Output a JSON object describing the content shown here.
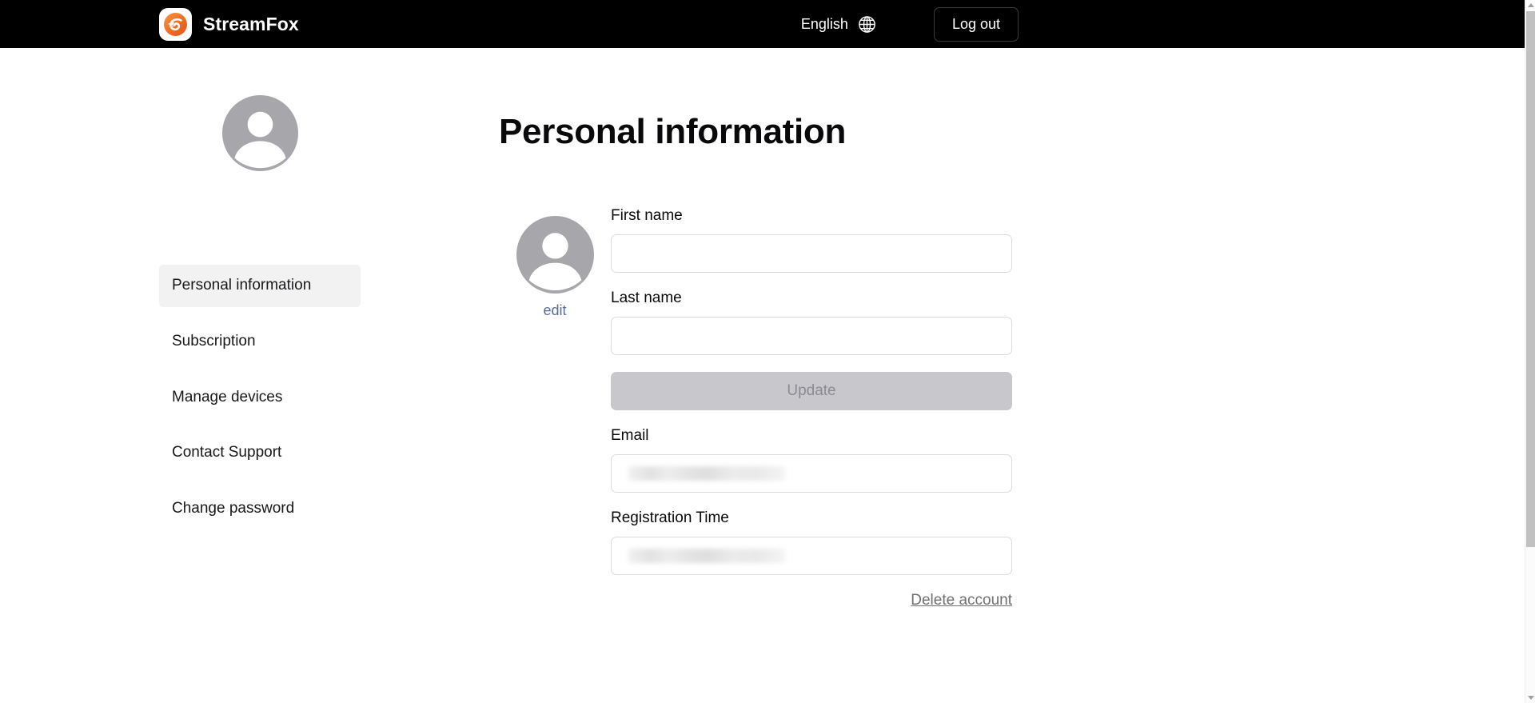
{
  "header": {
    "brand_name": "StreamFox",
    "brand_logo_icon": "streamfox-logo-icon",
    "language_label": "English",
    "globe_icon": "globe-icon",
    "logout_label": "Log out"
  },
  "sidebar": {
    "avatar_icon": "user-avatar-icon",
    "items": [
      {
        "label": "Personal information",
        "active": true
      },
      {
        "label": "Subscription",
        "active": false
      },
      {
        "label": "Manage devices",
        "active": false
      },
      {
        "label": "Contact Support",
        "active": false
      },
      {
        "label": "Change password",
        "active": false
      }
    ]
  },
  "main": {
    "page_title": "Personal information",
    "avatar_icon": "user-avatar-icon",
    "edit_label": "edit",
    "first_name": {
      "label": "First name",
      "value": "",
      "placeholder": ""
    },
    "last_name": {
      "label": "Last name",
      "value": "",
      "placeholder": ""
    },
    "update_label": "Update",
    "email": {
      "label": "Email",
      "value": "",
      "redacted": true
    },
    "registration_time": {
      "label": "Registration Time",
      "value": "",
      "redacted": true
    },
    "delete_account_label": "Delete account"
  },
  "colors": {
    "header_bg": "#000000",
    "brand_accent": "#ef6c23",
    "active_nav_bg": "#f2f2f2",
    "edit_link": "#5a6c9c",
    "disabled_button_bg": "#c8c8cc",
    "disabled_button_text": "#8a8a90",
    "input_border": "#dcdcdc",
    "delete_link": "#6f6f76"
  },
  "scrollbar": {
    "up_arrow_icon": "chevron-up-icon",
    "down_arrow_icon": "chevron-down-icon"
  }
}
